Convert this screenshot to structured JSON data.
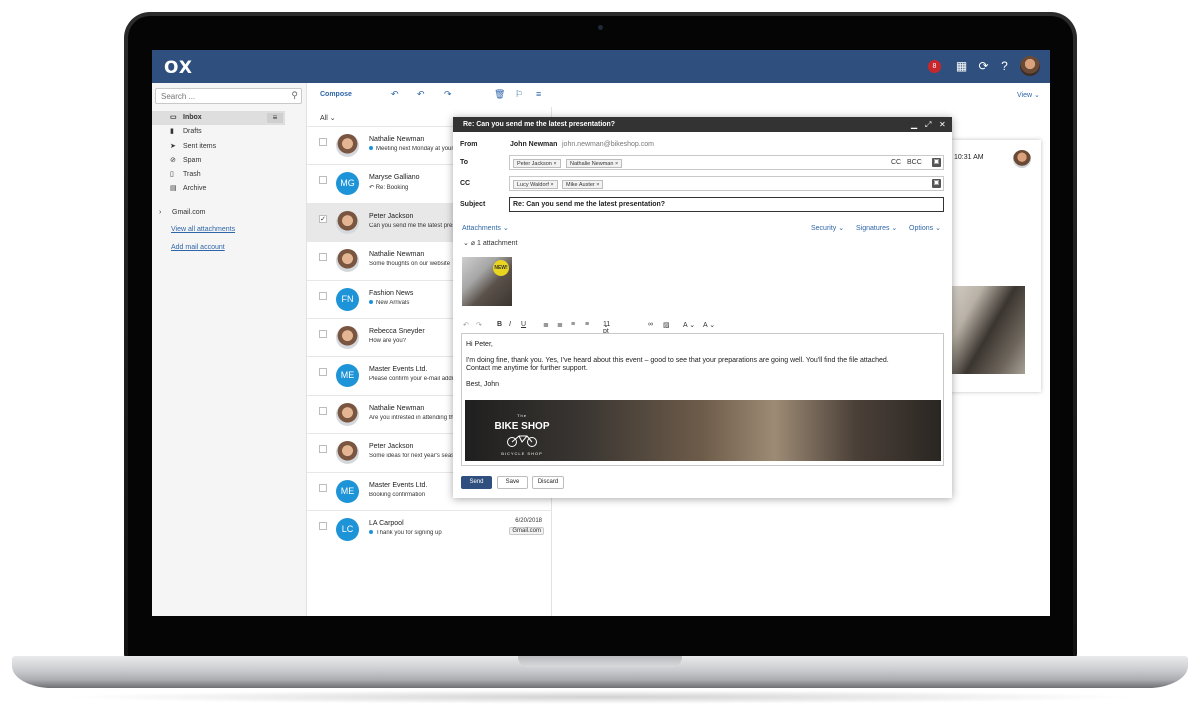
{
  "app": {
    "logo": "OX",
    "notification_count": "8"
  },
  "search": {
    "placeholder": "Search ..."
  },
  "folders": [
    {
      "label": "Inbox",
      "icon": "inbox-icon"
    },
    {
      "label": "Drafts",
      "icon": "drafts-icon"
    },
    {
      "label": "Sent items",
      "icon": "sent-icon"
    },
    {
      "label": "Spam",
      "icon": "spam-icon"
    },
    {
      "label": "Trash",
      "icon": "trash-icon"
    },
    {
      "label": "Archive",
      "icon": "archive-icon"
    }
  ],
  "sidebar": {
    "account": "Gmail.com",
    "view_all_attachments": "View all attachments",
    "add_mail_account": "Add mail account"
  },
  "toolbar": {
    "compose": "Compose",
    "view": "View"
  },
  "list": {
    "filter": "All",
    "rows": [
      {
        "name": "Nathalie Newman",
        "subject": "Meeting next Monday at your",
        "unread": true,
        "initials": "",
        "photo": true
      },
      {
        "name": "Maryse Galliano",
        "subject": "Re: Booking",
        "unread": false,
        "initials": "MG",
        "photo": false
      },
      {
        "name": "Peter Jackson",
        "subject": "Can you send me the latest presentation?",
        "unread": false,
        "initials": "",
        "photo": true
      },
      {
        "name": "Nathalie Newman",
        "subject": "Some thoughts on our website",
        "unread": false,
        "initials": "",
        "photo": true
      },
      {
        "name": "Fashion News",
        "subject": "New Arrivals",
        "unread": true,
        "initials": "FN",
        "photo": false
      },
      {
        "name": "Rebecca Sneyder",
        "subject": "How are you?",
        "unread": false,
        "initials": "",
        "photo": true
      },
      {
        "name": "Master Events Ltd.",
        "subject": "Please confirm your e-mail address",
        "unread": false,
        "initials": "ME",
        "photo": false
      },
      {
        "name": "Nathalie Newman",
        "subject": "Are you intrested in attending this",
        "unread": false,
        "initials": "",
        "photo": true
      },
      {
        "name": "Peter Jackson",
        "subject": "Some ideas for next year's season",
        "unread": false,
        "initials": "",
        "photo": true
      },
      {
        "name": "Master Events Ltd.",
        "subject": "Booking confirmation",
        "unread": false,
        "initials": "ME",
        "photo": false
      },
      {
        "name": "LA Carpool",
        "subject": "Thank you for signing up",
        "unread": true,
        "initials": "LC",
        "photo": false,
        "date": "6/20/2018",
        "tag": "Gmail.com"
      }
    ]
  },
  "reader": {
    "time": "10:31 AM"
  },
  "compose": {
    "title": "Re: Can you send me the latest presentation?",
    "labels": {
      "from": "From",
      "to": "To",
      "cc": "CC",
      "subject": "Subject"
    },
    "from_name": "John Newman",
    "from_email": "john.newman@bikeshop.com",
    "to": [
      "Peter Jackson",
      "Nathalie Newman"
    ],
    "cc": [
      "Lucy Waldorf",
      "Mike Auster"
    ],
    "cc_label": "CC",
    "bcc_label": "BCC",
    "subject": "Re: Can you send me the latest presentation?",
    "attachments_label": "Attachments",
    "security": "Security",
    "signatures": "Signatures",
    "options": "Options",
    "attachment_count": "1 attachment",
    "new_badge": "NEW!",
    "font_size": "11 pt",
    "body": {
      "greeting": "Hi Peter,",
      "line1": "I'm doing fine, thank you. Yes, I've heard about this event – good to see that your preparations are going well. You'll find the file attached.",
      "line2": "Contact me anytime for further support.",
      "signoff": "Best, John"
    },
    "banner": {
      "title_small": "The",
      "title": "BIKE SHOP",
      "subtitle": "BICYCLE SHOP"
    },
    "buttons": {
      "send": "Send",
      "save": "Save",
      "discard": "Discard"
    }
  },
  "colors": {
    "topbar": "#2f4f7e",
    "accent": "#2f66a8",
    "badge": "#c8262a",
    "avatar_blue": "#1d93d8"
  }
}
